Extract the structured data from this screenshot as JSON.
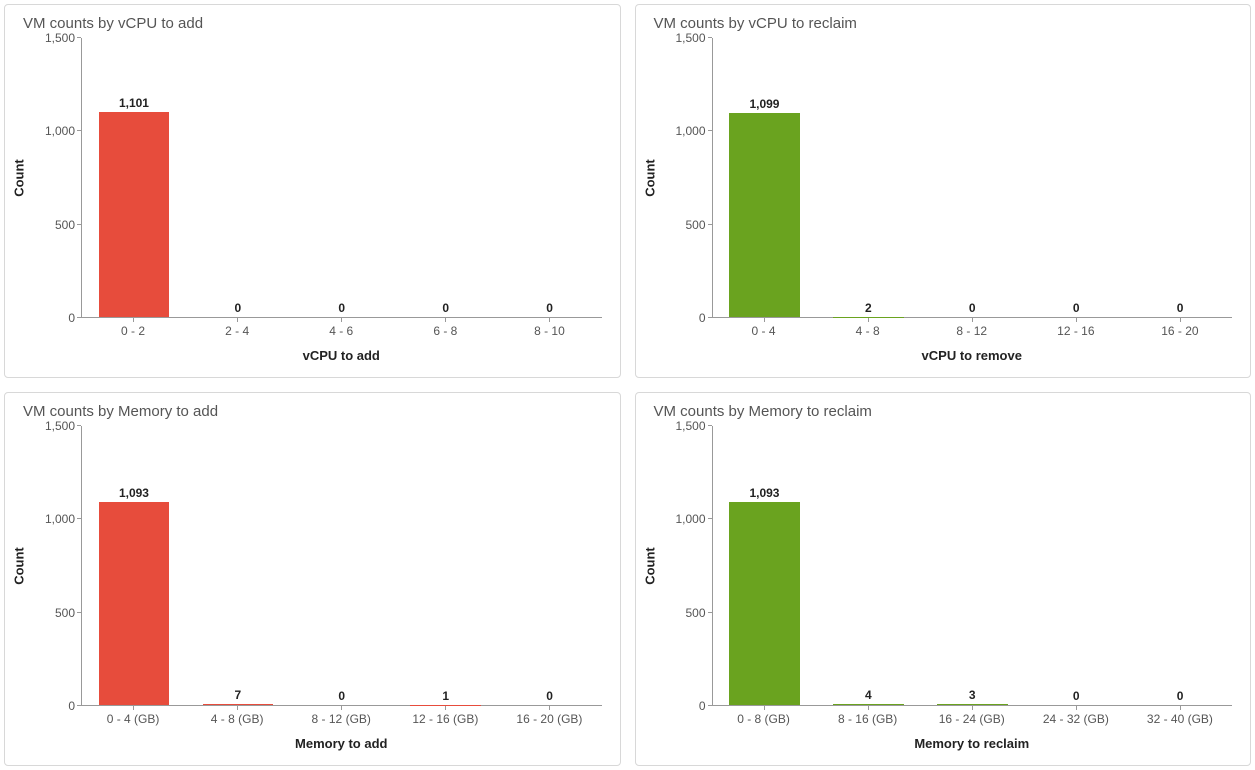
{
  "chart_data": [
    {
      "id": "vcpu-add",
      "type": "bar",
      "title": "VM counts by vCPU to add",
      "xlabel": "vCPU to add",
      "ylabel": "Count",
      "ylim": [
        0,
        1500
      ],
      "yticks": [
        0,
        500,
        1000,
        1500
      ],
      "ytick_labels": [
        "0",
        "500",
        "1,000",
        "1,500"
      ],
      "categories": [
        "0 - 2",
        "2 - 4",
        "4 - 6",
        "6 - 8",
        "8 - 10"
      ],
      "values": [
        1101,
        0,
        0,
        0,
        0
      ],
      "value_labels": [
        "1,101",
        "0",
        "0",
        "0",
        "0"
      ],
      "color": "red"
    },
    {
      "id": "vcpu-reclaim",
      "type": "bar",
      "title": "VM counts by vCPU to reclaim",
      "xlabel": "vCPU to remove",
      "ylabel": "Count",
      "ylim": [
        0,
        1500
      ],
      "yticks": [
        0,
        500,
        1000,
        1500
      ],
      "ytick_labels": [
        "0",
        "500",
        "1,000",
        "1,500"
      ],
      "categories": [
        "0 - 4",
        "4 - 8",
        "8 - 12",
        "12 - 16",
        "16 - 20"
      ],
      "values": [
        1099,
        2,
        0,
        0,
        0
      ],
      "value_labels": [
        "1,099",
        "2",
        "0",
        "0",
        "0"
      ],
      "color": "green"
    },
    {
      "id": "memory-add",
      "type": "bar",
      "title": "VM counts by Memory to add",
      "xlabel": "Memory to add",
      "ylabel": "Count",
      "ylim": [
        0,
        1500
      ],
      "yticks": [
        0,
        500,
        1000,
        1500
      ],
      "ytick_labels": [
        "0",
        "500",
        "1,000",
        "1,500"
      ],
      "categories": [
        "0 - 4 (GB)",
        "4 - 8 (GB)",
        "8 - 12 (GB)",
        "12 - 16 (GB)",
        "16 - 20 (GB)"
      ],
      "values": [
        1093,
        7,
        0,
        1,
        0
      ],
      "value_labels": [
        "1,093",
        "7",
        "0",
        "1",
        "0"
      ],
      "color": "red"
    },
    {
      "id": "memory-reclaim",
      "type": "bar",
      "title": "VM counts by Memory to reclaim",
      "xlabel": "Memory to reclaim",
      "ylabel": "Count",
      "ylim": [
        0,
        1500
      ],
      "yticks": [
        0,
        500,
        1000,
        1500
      ],
      "ytick_labels": [
        "0",
        "500",
        "1,000",
        "1,500"
      ],
      "categories": [
        "0 - 8 (GB)",
        "8 - 16 (GB)",
        "16 - 24 (GB)",
        "24 - 32 (GB)",
        "32 - 40 (GB)"
      ],
      "values": [
        1093,
        4,
        3,
        0,
        0
      ],
      "value_labels": [
        "1,093",
        "4",
        "3",
        "0",
        "0"
      ],
      "color": "green"
    }
  ]
}
